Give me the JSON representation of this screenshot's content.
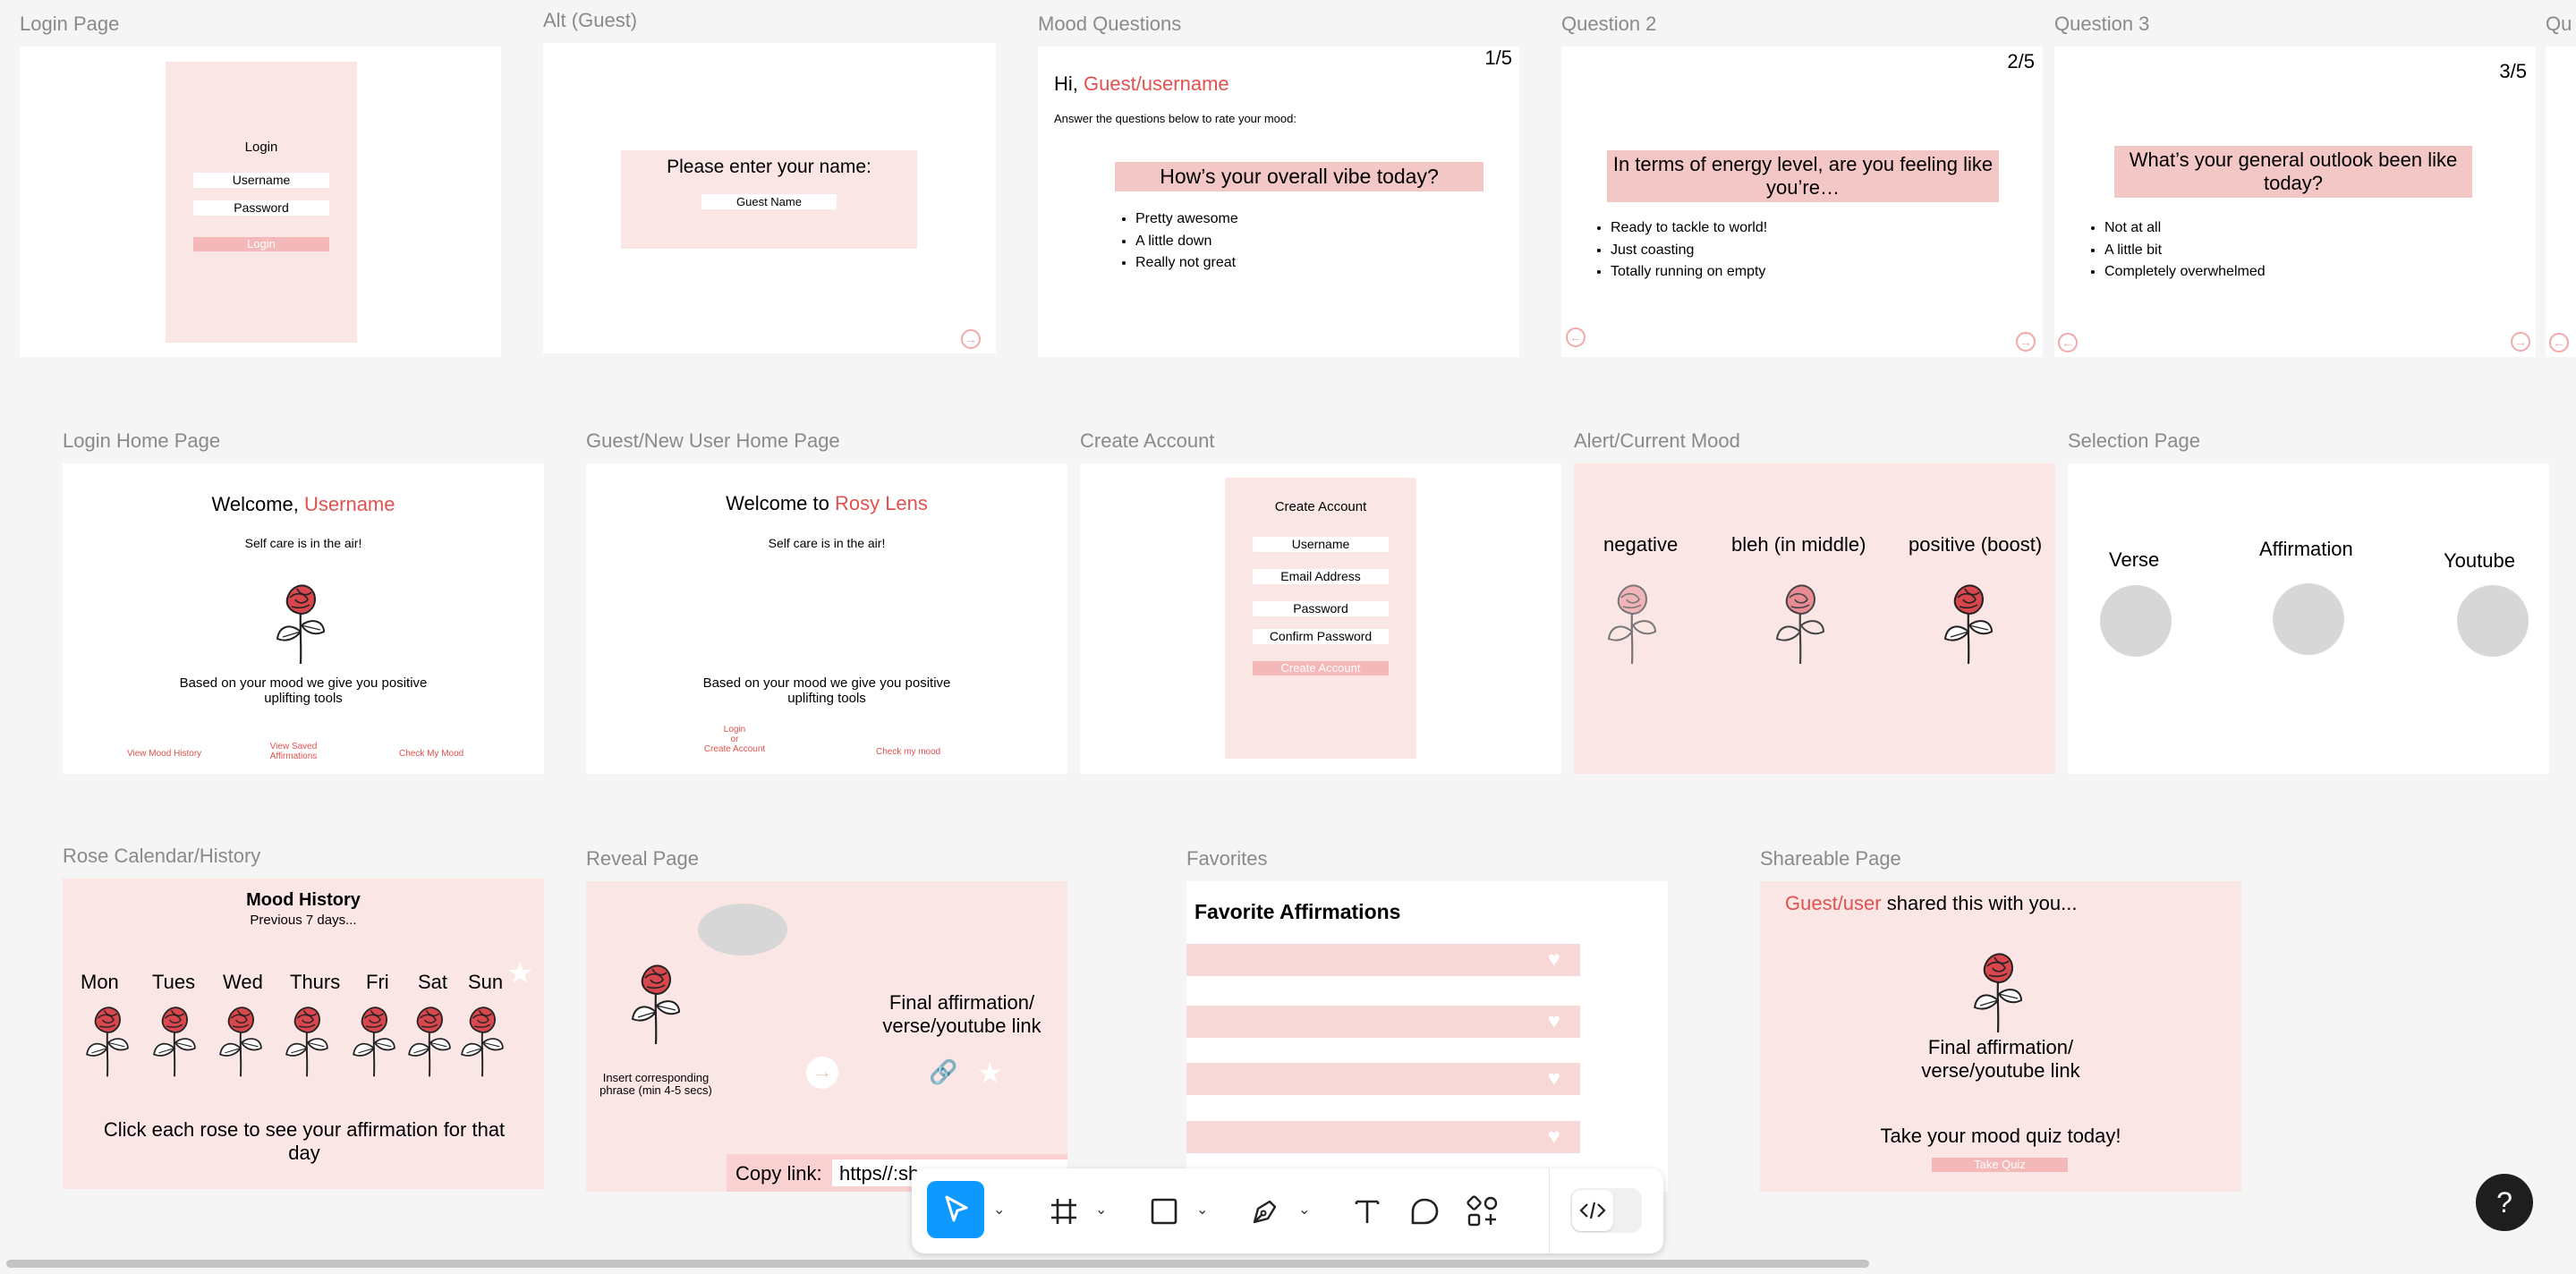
{
  "frames": {
    "login": {
      "label": "Login Page",
      "title": "Login",
      "username": "Username",
      "password": "Password",
      "button": "Login"
    },
    "alt": {
      "label": "Alt (Guest)",
      "prompt": "Please enter your name:",
      "field": "Guest Name"
    },
    "mood_q": {
      "label": "Mood Questions",
      "counter": "1/5",
      "greet": "Hi, ",
      "user": "Guest/username",
      "instr": "Answer the questions below to rate your mood:",
      "question": "How’s your overall vibe today?",
      "options": [
        "Pretty awesome",
        "A little down",
        "Really not great"
      ]
    },
    "q2": {
      "label": "Question 2",
      "counter": "2/5",
      "question": "In terms of energy level, are you feeling like you’re…",
      "options": [
        "Ready to tackle to world!",
        "Just coasting",
        "Totally running on empty"
      ]
    },
    "q3": {
      "label": "Question 3",
      "counter": "3/5",
      "question": "What’s your general outlook been like today?",
      "options": [
        "Not at all",
        "A little bit",
        "Completely overwhelmed"
      ]
    },
    "q4": {
      "label": "Qu"
    },
    "login_home": {
      "label": "Login Home Page",
      "welcome": "Welcome, ",
      "user": "Username",
      "sub": "Self care is in the air!",
      "desc": "Based on your mood we give you positive uplifting tools",
      "links": [
        "View Mood History",
        "View Saved Affirmations",
        "Check My Mood"
      ]
    },
    "guest_home": {
      "label": "Guest/New User Home Page",
      "welcome": "Welcome to ",
      "brand": "Rosy Lens",
      "sub": "Self care is in the air!",
      "desc": "Based on your mood we give you positive uplifting tools",
      "link_login": "Login",
      "link_or": "or",
      "link_create": "Create Account",
      "link_check": "Check my mood"
    },
    "create": {
      "label": "Create Account",
      "title": "Create Account",
      "fields": [
        "Username",
        "Email Address",
        "Password",
        "Confirm Password"
      ],
      "button": "Create Account"
    },
    "alert": {
      "label": "Alert/Current Mood",
      "moods": [
        "negative",
        "bleh (in middle)",
        "positive (boost)"
      ]
    },
    "selection": {
      "label": "Selection Page",
      "options": [
        "Verse",
        "Affirmation",
        "Youtube"
      ]
    },
    "calendar": {
      "label": "Rose Calendar/History",
      "title": "Mood History",
      "sub": "Previous 7 days...",
      "days": [
        "Mon",
        "Tues",
        "Wed",
        "Thurs",
        "Fri",
        "Sat",
        "Sun"
      ],
      "footer": "Click each rose to see your affirmation for that day"
    },
    "reveal": {
      "label": "Reveal Page",
      "phrase": "Insert corresponding phrase (min 4-5 secs)",
      "final": "Final affirmation/ verse/youtube link",
      "copy": "Copy link:",
      "url": "https//:sh"
    },
    "favorites": {
      "label": "Favorites",
      "title": "Favorite Affirmations"
    },
    "share": {
      "label": "Shareable Page",
      "user": "Guest/user",
      "shared": " shared this with you...",
      "final": "Final affirmation/ verse/youtube link",
      "cta": "Take your mood quiz today!",
      "button": "Take Quiz"
    }
  },
  "toolbar": {
    "tools": [
      "move-tool",
      "frame-tool",
      "shape-tool",
      "pen-tool",
      "text-tool",
      "comment-tool",
      "actions-tool",
      "dev-mode-toggle"
    ]
  },
  "help": "?",
  "colors": {
    "accent": "#e0524f",
    "pink": "#fbe6e6",
    "toolbar_active": "#0d99ff",
    "canvas": "#f5f5f5"
  }
}
